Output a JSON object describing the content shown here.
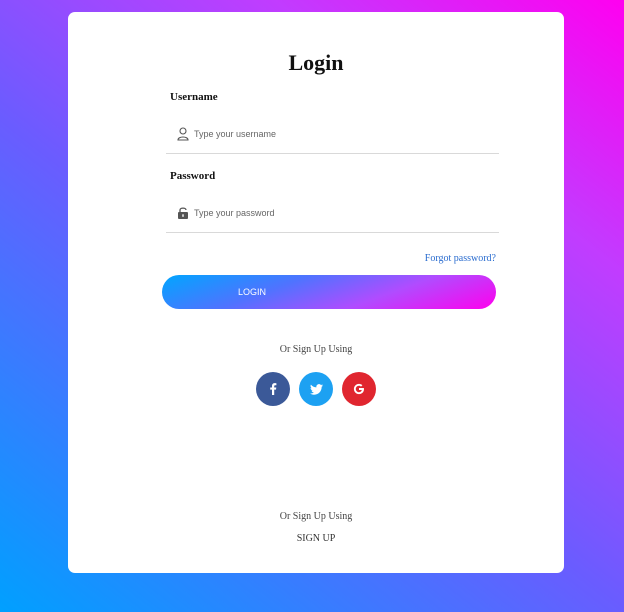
{
  "form": {
    "title": "Login",
    "username": {
      "label": "Username",
      "placeholder": "Type your username",
      "value": "",
      "icon": "user-icon"
    },
    "password": {
      "label": "Password",
      "placeholder": "Type your password",
      "value": "",
      "icon": "lock-icon"
    },
    "forgot_password": "Forgot password?",
    "login_button": "LOGIN"
  },
  "social": {
    "heading": "Or Sign Up Using",
    "buttons": [
      {
        "name": "facebook",
        "icon": "facebook-icon",
        "color": "#3b5998"
      },
      {
        "name": "twitter",
        "icon": "twitter-icon",
        "color": "#1da1f2"
      },
      {
        "name": "google",
        "icon": "google-icon",
        "color": "#e0262f"
      }
    ]
  },
  "footer": {
    "heading": "Or Sign Up Using",
    "signup_link": "SIGN UP"
  },
  "colors": {
    "gradient_start": "#00a0ff",
    "gradient_end": "#ff00f0",
    "link": "#2a6ccf"
  }
}
